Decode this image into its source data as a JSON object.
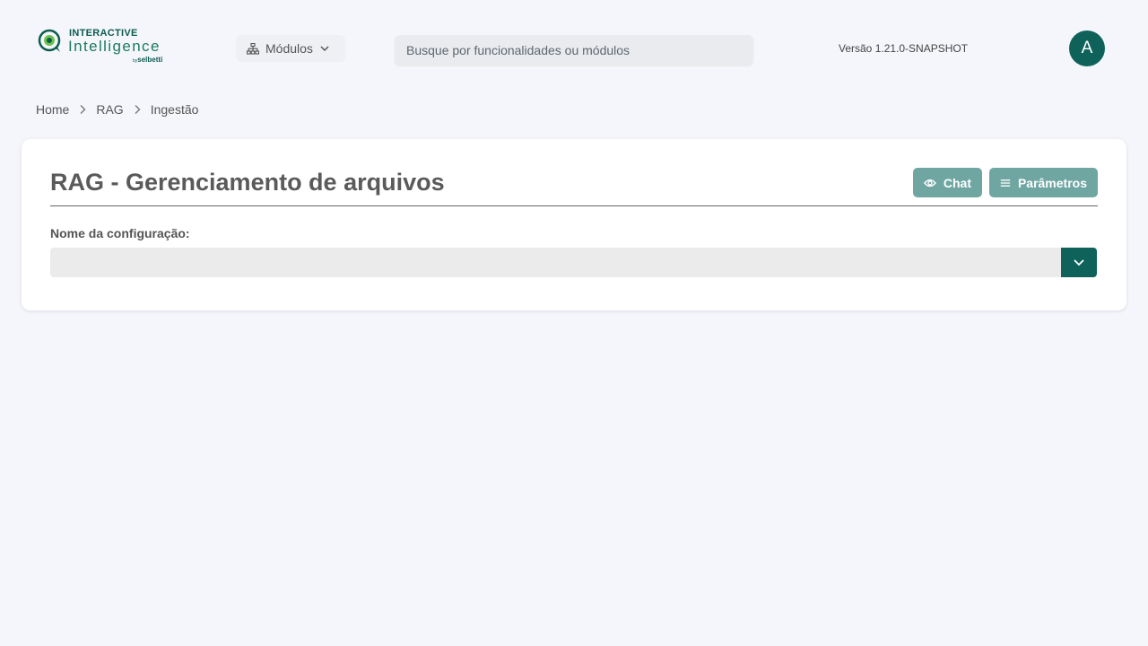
{
  "brand": {
    "line1": "INTERACTIVE",
    "line2": "Intelligence",
    "by": "by",
    "company": "selbetti"
  },
  "nav": {
    "modules_label": "Módulos",
    "search_placeholder": "Busque por funcionalidades ou módulos",
    "version": "Versão 1.21.0-SNAPSHOT",
    "avatar_initial": "A"
  },
  "breadcrumb": {
    "items": [
      "Home",
      "RAG",
      "Ingestão"
    ]
  },
  "page": {
    "title": "RAG - Gerenciamento de arquivos",
    "chat_button": "Chat",
    "params_button": "Parâmetros",
    "config_label": "Nome da configuração:",
    "config_value": ""
  },
  "colors": {
    "accent": "#0f625a",
    "button_bg": "#6fa6a2",
    "brand_green": "#1d7a5f",
    "page_bg": "#f4f6fb"
  },
  "icons": {
    "modules": "sitemap-icon",
    "modules_chevron": "chevron-down-icon",
    "breadcrumb_sep": "chevron-right-icon",
    "chat": "eye-icon",
    "params": "menu-lines-icon",
    "select_toggle": "chevron-down-icon"
  }
}
